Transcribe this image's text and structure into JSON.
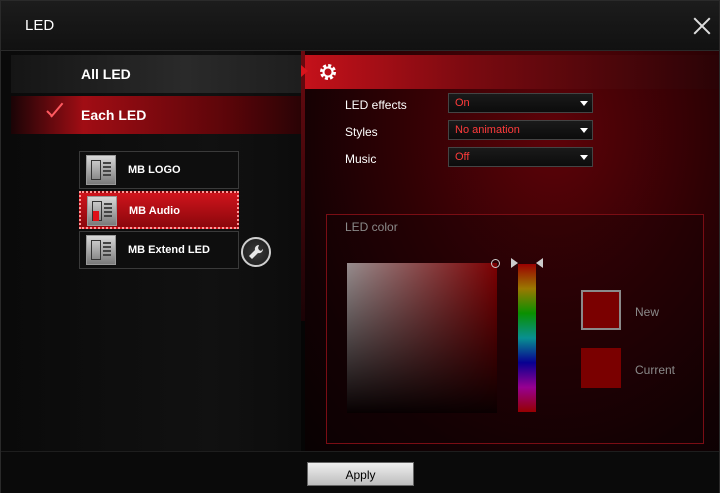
{
  "window": {
    "title": "LED"
  },
  "modes": {
    "all": "All LED",
    "each": "Each LED"
  },
  "devices": [
    "MB LOGO",
    "MB Audio",
    "MB Extend LED"
  ],
  "settings": {
    "led_effects_label": "LED effects",
    "led_effects_value": "On",
    "styles_label": "Styles",
    "styles_value": "No animation",
    "music_label": "Music",
    "music_value": "Off"
  },
  "led_color": {
    "title": "LED color",
    "new_label": "New",
    "current_label": "Current",
    "new_color": "#7a0000",
    "current_color": "#7a0000"
  },
  "footer": {
    "apply_label": "Apply"
  },
  "colors": {
    "accent": "#d8141c",
    "select_text": "#ff3b3b"
  },
  "icons": [
    "close-icon",
    "checkmark-icon",
    "gear-icon",
    "wrench-icon",
    "motherboard-icon",
    "dropdown-caret-icon"
  ]
}
